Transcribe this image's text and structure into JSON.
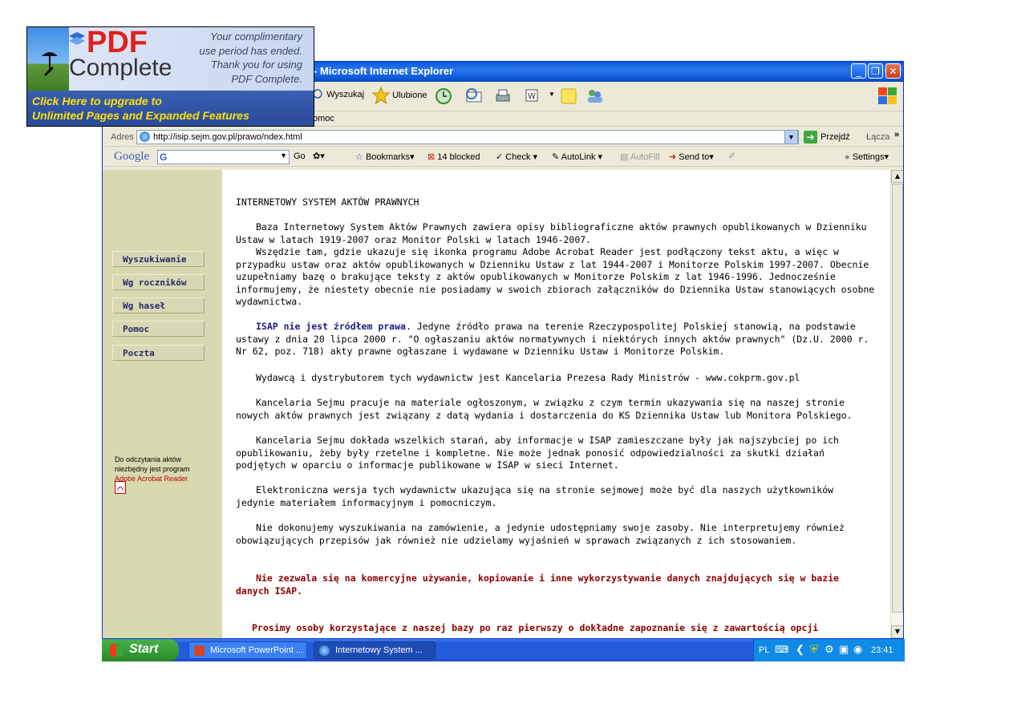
{
  "window": {
    "title": "- Microsoft Internet Explorer",
    "buttons": {
      "minimize": "_",
      "maximize": "❐",
      "close": "✕"
    }
  },
  "toolbar": {
    "search_label": "Wyszukaj",
    "favorites_label": "Ulubione"
  },
  "menu": {
    "help_partial": "omoc"
  },
  "address_bar": {
    "label": "Adres",
    "url": "http://isip.sejm.gov.pl/prawo/ndex.html",
    "go_label": "Przejdź",
    "links_label": "Łącza"
  },
  "google_bar": {
    "logo": "Google",
    "go_label": "Go",
    "bookmarks_label": "Bookmarks",
    "blocked_label": "14 blocked",
    "check_label": "Check",
    "autolink_label": "AutoLink",
    "autofill_label": "AutoFill",
    "sendto_label": "Send to",
    "settings_label": "Settings"
  },
  "sidebar": {
    "items": [
      {
        "label": "Wyszukiwanie"
      },
      {
        "label": "Wg roczników"
      },
      {
        "label": "Wg haseł"
      },
      {
        "label": "Pomoc"
      },
      {
        "label": "Poczta"
      }
    ],
    "acrobat_note_line1": "Do odczytania aktów",
    "acrobat_note_line2": "niezbędny jest program",
    "acrobat_link": "Adobe Acrobat Reader"
  },
  "content": {
    "heading": "INTERNETOWY SYSTEM AKTÓW PRAWNYCH",
    "p1": "Baza Internetowy System Aktów Prawnych zawiera opisy bibliograficzne aktów prawnych opublikowanych w Dzienniku Ustaw w latach 1919-2007 oraz Monitor Polski w latach 1946-2007.",
    "p2": "Wszędzie tam, gdzie ukazuje się ikonka programu Adobe Acrobat Reader jest podłączony tekst aktu, a więc w przypadku ustaw oraz aktów opublikowanych w Dzienniku Ustaw z lat 1944-2007 i Monitorze Polskim 1997-2007. Obecnie uzupełniamy bazę o brakujące teksty z aktów opublikowanych w Monitorze Polskim z lat 1946-1996. Jednocześnie informujemy, że niestety obecnie nie posiadamy w swoich zbiorach załączników do Dziennika Ustaw stanowiących osobne wydawnictwa.",
    "p3_strong": "ISAP nie jest źródłem prawa",
    "p3_rest": ". Jedyne źródło prawa na terenie Rzeczypospolitej Polskiej stanowią, na podstawie ustawy z dnia 20 lipca 2000 r. \"O ogłaszaniu aktów normatywnych i niektórych innych aktów prawnych\" (Dz.U. 2000 r. Nr 62, poz. 718) akty prawne ogłaszane i wydawane w Dzienniku Ustaw i Monitorze Polskim.",
    "p4": "Wydawcą i dystrybutorem tych wydawnictw jest Kancelaria Prezesa Rady Ministrów - www.cokprm.gov.pl",
    "p5": "Kancelaria Sejmu pracuje na materiale ogłoszonym, w związku z czym termin ukazywania się na naszej stronie nowych aktów prawnych jest związany z datą wydania i dostarczenia do KS Dziennika Ustaw lub Monitora Polskiego.",
    "p6": "Kancelaria Sejmu dokłada wszelkich starań, aby informacje w ISAP zamieszczane były jak najszybciej po ich opublikowaniu, żeby były rzetelne i kompletne. Nie może jednak ponosić odpowiedzialności za skutki działań podjętych w oparciu o informacje publikowane w ISAP w sieci Internet.",
    "p7": "Elektroniczna wersja tych wydawnictw ukazująca się na stronie sejmowej może być dla naszych użytkowników jedynie materiałem informacyjnym i pomocniczym.",
    "p8": "Nie dokonujemy wyszukiwania na zamówienie, a jedynie udostępniamy swoje zasoby. Nie interpretujemy również obowiązujących przepisów jak również nie udzielamy wyjaśnień w sprawach związanych z ich stosowaniem.",
    "p9": "Nie zezwala się na komercyjne używanie, kopiowanie i inne wykorzystywanie danych znajdujących się w bazie danych ISAP.",
    "p10": "Prosimy osoby korzystające z naszej bazy po raz pierwszy o dokładne zapoznanie się z zawartością opcji"
  },
  "taskbar": {
    "start_label": "Start",
    "tasks": [
      {
        "label": "Microsoft PowerPoint ..."
      },
      {
        "label": "Internetowy System ..."
      }
    ],
    "tray_lang": "PL",
    "clock": "23:41"
  },
  "pdf_ad": {
    "logo_pdf": "PDF",
    "logo_complete": "Complete",
    "message_line1": "Your complimentary",
    "message_line2": "use period has ended.",
    "message_line3": "Thank you for using",
    "message_line4": "PDF Complete.",
    "upgrade_line1": "Click Here to upgrade to",
    "upgrade_line2": "Unlimited Pages and Expanded Features"
  }
}
